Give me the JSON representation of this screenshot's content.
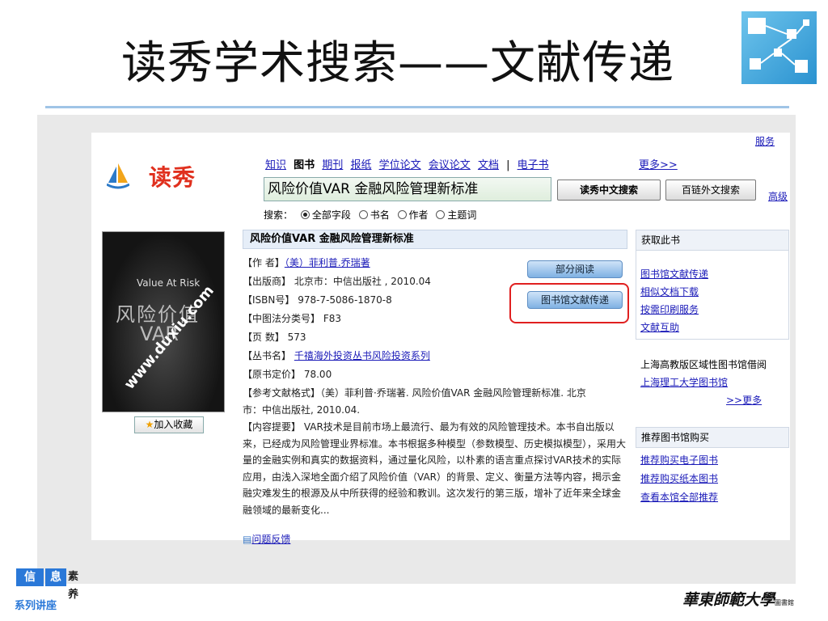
{
  "slide": {
    "title": "读秀学术搜索——文献传递",
    "footer": {
      "tag_part1": "信",
      "tag_part2": "息",
      "tag_part3": "素养",
      "series": "系列讲座",
      "university": "華東師範大學",
      "library": "圖書館"
    }
  },
  "duxiu": {
    "logo_text": "读秀",
    "service_link": "服务",
    "nav": [
      {
        "label": "知识",
        "current": false
      },
      {
        "label": "图书",
        "current": true
      },
      {
        "label": "期刊",
        "current": false
      },
      {
        "label": "报纸",
        "current": false
      },
      {
        "label": "学位论文",
        "current": false
      },
      {
        "label": "会议论文",
        "current": false
      },
      {
        "label": "文档",
        "current": false
      },
      {
        "label": "|",
        "current": false
      },
      {
        "label": "电子书",
        "current": false
      }
    ],
    "more_link": "更多>>",
    "search_value": "风险价值VAR  金融风险管理新标准",
    "btn_cn_search": "读秀中文搜索",
    "btn_en_search": "百链外文搜索",
    "advanced_link": "高级",
    "scope_label": "搜索：",
    "scope_options": [
      "全部字段",
      "书名",
      "作者",
      "主题词"
    ],
    "scope_selected": "全部字段"
  },
  "book": {
    "cover": {
      "en_title": "Value At Risk",
      "cn_title": "风险价值",
      "var": "VAR",
      "watermark": "www.duxiu.com"
    },
    "add_favorite": "加入收藏",
    "title": "风险价值VAR 金融风险管理新标准",
    "fields": [
      {
        "key": "【作  者】",
        "value": "（美）菲利普.乔瑞著",
        "link": true
      },
      {
        "key": "【出版商】",
        "value": "北京市：中信出版社 , 2010.04",
        "link": false
      },
      {
        "key": "【ISBN号】",
        "value": "978-7-5086-1870-8",
        "link": false
      },
      {
        "key": "【中图法分类号】",
        "value": "F83",
        "link": false
      },
      {
        "key": "【页  数】",
        "value": "573",
        "link": false
      },
      {
        "key": "【丛书名】",
        "value": "千禧海外投资丛书风险投资系列",
        "link": true
      },
      {
        "key": "【原书定价】",
        "value": "78.00",
        "link": false
      }
    ],
    "citation_line1": "【参考文献格式】（美）菲利普·乔瑞著. 风险价值VAR 金融风险管理新标准. 北京",
    "citation_line2": "市：中信出版社, 2010.04.",
    "summary": "【内容提要】 VAR技术是目前市场上最流行、最为有效的风险管理技术。本书自出版以来，已经成为风险管理业界标准。本书根据多种模型（参数模型、历史模拟模型），采用大量的金融实例和真实的数据资料，通过量化风险，以朴素的语言重点探讨VAR技术的实际应用，由浅入深地全面介绍了风险价值（VAR）的背景、定义、衡量方法等内容，揭示金融灾难发生的根源及从中所获得的经验和教训。这次发行的第三版，增补了近年来全球金融领域的最新变化...",
    "feedback": "问题反馈",
    "btn_partial_read": "部分阅读",
    "btn_doc_delivery": "图书馆文献传递"
  },
  "sidebar": {
    "get_head": "获取此书",
    "get_links": [
      "图书馆文献传递",
      "相似文档下载",
      "按需印刷服务",
      "文献互助"
    ],
    "region_text": "上海高教版区域性图书馆借阅",
    "region_link": "上海理工大学图书馆",
    "region_more": ">>更多",
    "recommend_head": "推荐图书馆购买",
    "recommend_links": [
      "推荐购买电子图书",
      "推荐购买纸本图书",
      "查看本馆全部推荐"
    ]
  },
  "colors": {
    "accent": "#2a78d8",
    "link": "#1a1ab8",
    "highlight": "#e02020",
    "rule": "#9fc4e6"
  }
}
